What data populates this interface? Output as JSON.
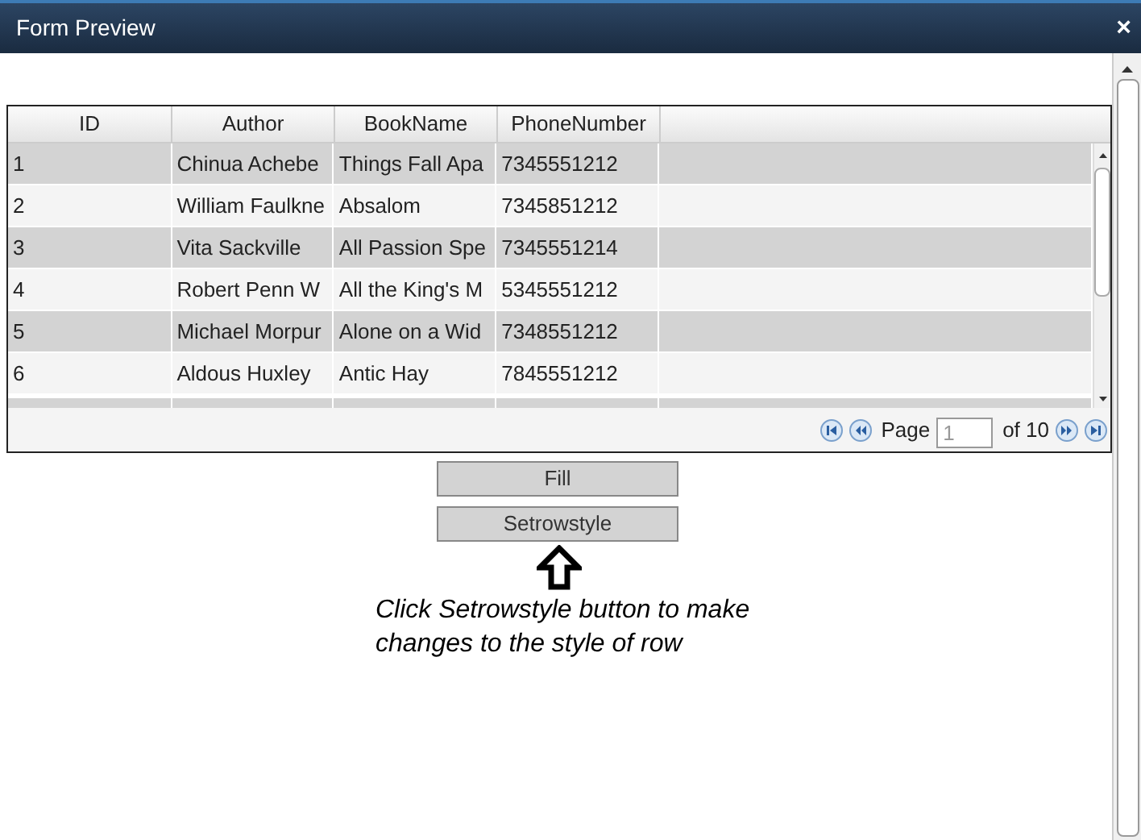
{
  "window": {
    "title": "Form Preview",
    "close": "×"
  },
  "grid": {
    "columns": [
      "ID",
      "Author",
      "BookName",
      "PhoneNumber"
    ],
    "rows": [
      [
        "1",
        "Chinua Achebe",
        "Things Fall Apa",
        "7345551212"
      ],
      [
        "2",
        "William Faulkne",
        "Absalom",
        "7345851212"
      ],
      [
        "3",
        "Vita Sackville",
        "All Passion Spe",
        "7345551214"
      ],
      [
        "4",
        "Robert Penn W",
        "All the King's M",
        "5345551212"
      ],
      [
        "5",
        "Michael Morpur",
        "Alone on a Wid",
        "7348551212"
      ],
      [
        "6",
        "Aldous Huxley",
        "Antic Hay",
        "7845551212"
      ]
    ],
    "pager": {
      "label": "Page",
      "value": "1",
      "total": "of 10"
    }
  },
  "buttons": [
    "Fill",
    "Setrowstyle"
  ],
  "note": "Click Setrowstyle button to make changes to the style of row"
}
